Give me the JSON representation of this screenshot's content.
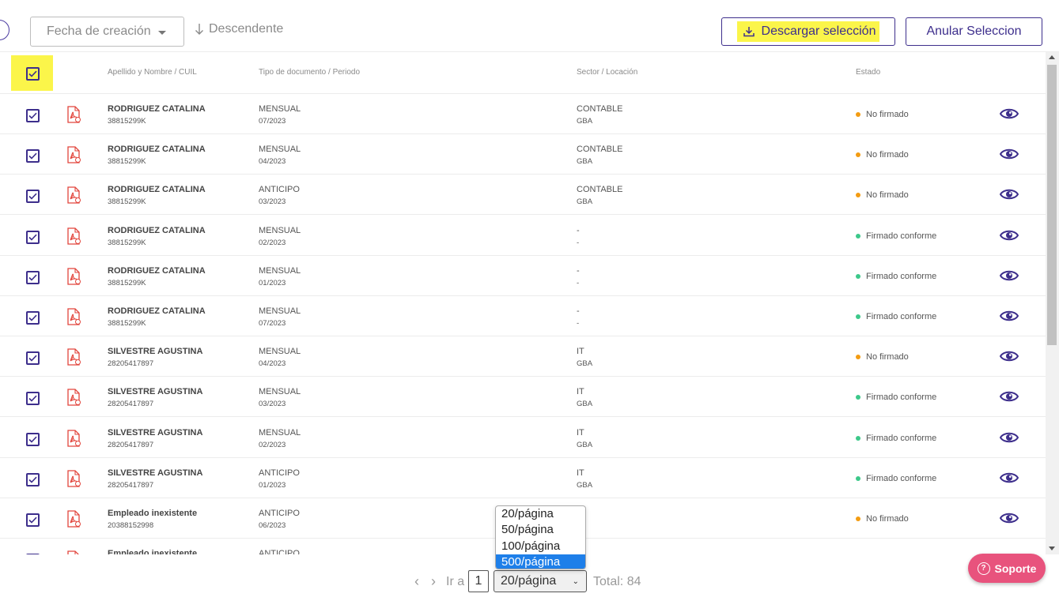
{
  "toolbar": {
    "sort_field": "Fecha de creación",
    "sort_direction": "Descendente",
    "download_label": "Descargar selección",
    "cancel_label": "Anular Seleccion"
  },
  "table": {
    "headers": {
      "name": "Apellido y Nombre / CUIL",
      "doc": "Tipo de documento / Periodo",
      "sector": "Sector / Locación",
      "status": "Estado"
    },
    "rows": [
      {
        "name": "RODRIGUEZ CATALINA",
        "cuil": "38815299K",
        "doc_type": "MENSUAL",
        "period": "07/2023",
        "sector": "CONTABLE",
        "location": "GBA",
        "status": "No firmado",
        "status_color": "#f39c12"
      },
      {
        "name": "RODRIGUEZ CATALINA",
        "cuil": "38815299K",
        "doc_type": "MENSUAL",
        "period": "04/2023",
        "sector": "CONTABLE",
        "location": "GBA",
        "status": "No firmado",
        "status_color": "#f39c12"
      },
      {
        "name": "RODRIGUEZ CATALINA",
        "cuil": "38815299K",
        "doc_type": "ANTICIPO",
        "period": "03/2023",
        "sector": "CONTABLE",
        "location": "GBA",
        "status": "No firmado",
        "status_color": "#f39c12"
      },
      {
        "name": "RODRIGUEZ CATALINA",
        "cuil": "38815299K",
        "doc_type": "MENSUAL",
        "period": "02/2023",
        "sector": "-",
        "location": "-",
        "status": "Firmado conforme",
        "status_color": "#3cc88a"
      },
      {
        "name": "RODRIGUEZ CATALINA",
        "cuil": "38815299K",
        "doc_type": "MENSUAL",
        "period": "01/2023",
        "sector": "-",
        "location": "-",
        "status": "Firmado conforme",
        "status_color": "#3cc88a"
      },
      {
        "name": "RODRIGUEZ CATALINA",
        "cuil": "38815299K",
        "doc_type": "MENSUAL",
        "period": "07/2023",
        "sector": "-",
        "location": "-",
        "status": "Firmado conforme",
        "status_color": "#3cc88a"
      },
      {
        "name": "SILVESTRE AGUSTINA",
        "cuil": "28205417897",
        "doc_type": "MENSUAL",
        "period": "04/2023",
        "sector": "IT",
        "location": "GBA",
        "status": "No firmado",
        "status_color": "#f39c12"
      },
      {
        "name": "SILVESTRE AGUSTINA",
        "cuil": "28205417897",
        "doc_type": "MENSUAL",
        "period": "03/2023",
        "sector": "IT",
        "location": "GBA",
        "status": "Firmado conforme",
        "status_color": "#3cc88a"
      },
      {
        "name": "SILVESTRE AGUSTINA",
        "cuil": "28205417897",
        "doc_type": "MENSUAL",
        "period": "02/2023",
        "sector": "IT",
        "location": "GBA",
        "status": "Firmado conforme",
        "status_color": "#3cc88a"
      },
      {
        "name": "SILVESTRE AGUSTINA",
        "cuil": "28205417897",
        "doc_type": "ANTICIPO",
        "period": "01/2023",
        "sector": "IT",
        "location": "GBA",
        "status": "Firmado conforme",
        "status_color": "#3cc88a"
      },
      {
        "name": "Empleado inexistente",
        "cuil": "20388152998",
        "doc_type": "ANTICIPO",
        "period": "06/2023",
        "sector": "",
        "location": "",
        "status": "No firmado",
        "status_color": "#f39c12"
      },
      {
        "name": "Empleado inexistente",
        "cuil": "",
        "doc_type": "ANTICIPO",
        "period": "",
        "sector": "",
        "location": "",
        "status": "",
        "status_color": "#f39c12"
      }
    ]
  },
  "pagination": {
    "goto_label": "Ir a",
    "current_page": "1",
    "page_size": "20/página",
    "page_size_options": [
      "20/página",
      "50/página",
      "100/página",
      "500/página"
    ],
    "highlighted_option": "500/página",
    "total": "Total: 84"
  },
  "support": {
    "label": "Soporte"
  },
  "colors": {
    "accent": "#3d2e8c",
    "highlight": "#fbf54a",
    "pdf_red": "#e2453c",
    "support_pink": "#e8537d",
    "dropdown_selected": "#1e7fe9"
  },
  "icons": {
    "sort_direction": "arrow-down-icon",
    "download": "download-icon",
    "file": "pdf-file-icon",
    "view": "eye-icon",
    "help": "question-circle-icon"
  }
}
